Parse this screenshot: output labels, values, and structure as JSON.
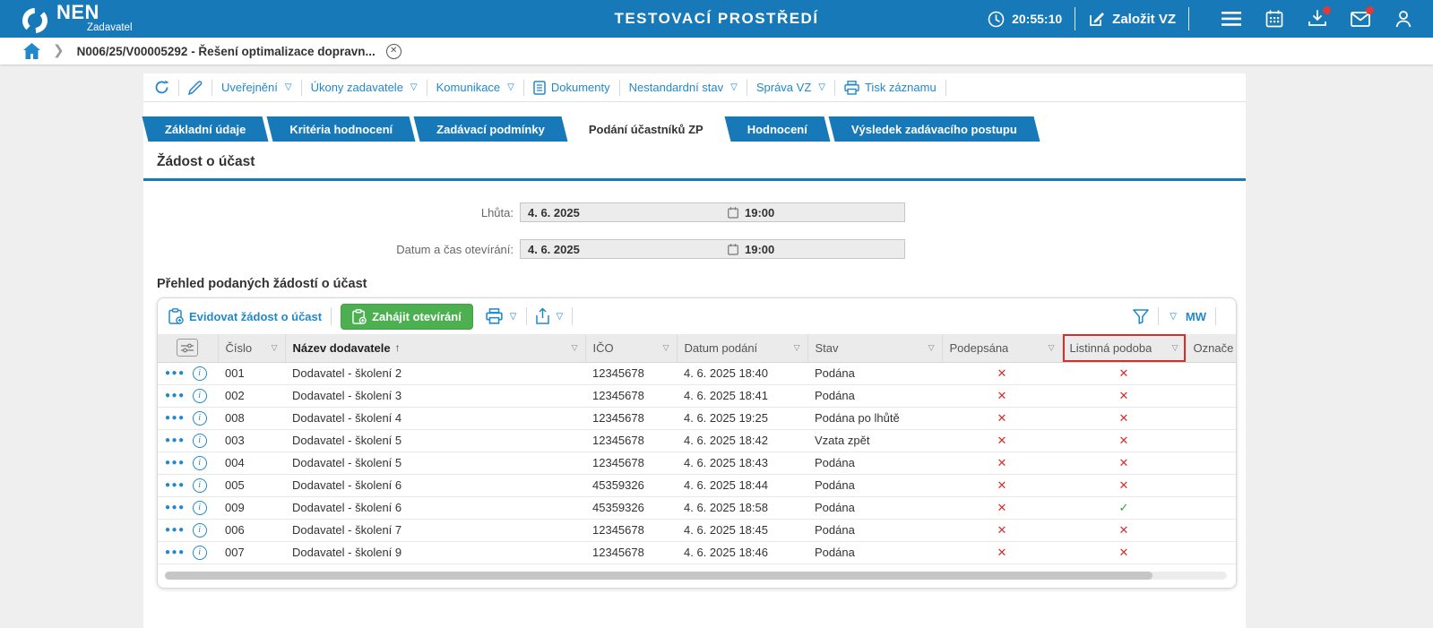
{
  "topbar": {
    "brand": "NEN",
    "brand_sub": "Zadavatel",
    "env_title": "TESTOVACÍ PROSTŘEDÍ",
    "time": "20:55:10",
    "create_vz": "Založit VZ"
  },
  "breadcrumb": {
    "item": "N006/25/V00005292 - Řešení optimalizace dopravn..."
  },
  "toolbar": {
    "uverejneni": "Uveřejnění",
    "ukony": "Úkony zadavatele",
    "komunikace": "Komunikace",
    "dokumenty": "Dokumenty",
    "nestandardni": "Nestandardní stav",
    "sprava": "Správa VZ",
    "tisk": "Tisk záznamu"
  },
  "tabs": {
    "items": [
      {
        "label": "Základní údaje"
      },
      {
        "label": "Kritéria hodnocení"
      },
      {
        "label": "Zadávací podmínky"
      },
      {
        "label": "Podání účastníků ZP"
      },
      {
        "label": "Hodnocení"
      },
      {
        "label": "Výsledek zadávacího postupu"
      }
    ],
    "active": "Podání účastníků ZP"
  },
  "section": {
    "title": "Žádost o účast"
  },
  "fields": {
    "lhuta": {
      "label": "Lhůta:",
      "date": "4. 6. 2025",
      "time": "19:00"
    },
    "oteviranie": {
      "label": "Datum a čas otevírání:",
      "date": "4. 6. 2025",
      "time": "19:00"
    }
  },
  "table": {
    "title": "Přehled podaných žádostí o účast",
    "actions": {
      "evidovat": "Evidovat žádost o účast",
      "zahajit": "Zahájit otevírání",
      "mw": "MW"
    },
    "columns": {
      "cislo": "Číslo",
      "nazev": "Název dodavatele",
      "ico": "IČO",
      "datum": "Datum podání",
      "stav": "Stav",
      "podepsana": "Podepsána",
      "listinna": "Listinná podoba",
      "oznacena": "Označe"
    },
    "rows": [
      {
        "cislo": "001",
        "nazev": "Dodavatel - školení 2",
        "ico": "12345678",
        "datum": "4. 6. 2025 18:40",
        "stav": "Podána",
        "podepsana": "✕",
        "listinna": "✕"
      },
      {
        "cislo": "002",
        "nazev": "Dodavatel - školení 3",
        "ico": "12345678",
        "datum": "4. 6. 2025 18:41",
        "stav": "Podána",
        "podepsana": "✕",
        "listinna": "✕"
      },
      {
        "cislo": "008",
        "nazev": "Dodavatel - školení 4",
        "ico": "12345678",
        "datum": "4. 6. 2025 19:25",
        "stav": "Podána po lhůtě",
        "podepsana": "✕",
        "listinna": "✕"
      },
      {
        "cislo": "003",
        "nazev": "Dodavatel - školení 5",
        "ico": "12345678",
        "datum": "4. 6. 2025 18:42",
        "stav": "Vzata zpět",
        "podepsana": "✕",
        "listinna": "✕"
      },
      {
        "cislo": "004",
        "nazev": "Dodavatel - školení 5",
        "ico": "12345678",
        "datum": "4. 6. 2025 18:43",
        "stav": "Podána",
        "podepsana": "✕",
        "listinna": "✕"
      },
      {
        "cislo": "005",
        "nazev": "Dodavatel - školení 6",
        "ico": "45359326",
        "datum": "4. 6. 2025 18:44",
        "stav": "Podána",
        "podepsana": "✕",
        "listinna": "✕"
      },
      {
        "cislo": "009",
        "nazev": "Dodavatel - školení 6",
        "ico": "45359326",
        "datum": "4. 6. 2025 18:58",
        "stav": "Podána",
        "podepsana": "✕",
        "listinna": "✓"
      },
      {
        "cislo": "006",
        "nazev": "Dodavatel - školení 7",
        "ico": "12345678",
        "datum": "4. 6. 2025 18:45",
        "stav": "Podána",
        "podepsana": "✕",
        "listinna": "✕"
      },
      {
        "cislo": "007",
        "nazev": "Dodavatel - školení 9",
        "ico": "12345678",
        "datum": "4. 6. 2025 18:46",
        "stav": "Podána",
        "podepsana": "✕",
        "listinna": "✕"
      }
    ]
  },
  "colors": {
    "brand_blue": "#1779b7",
    "link_blue": "#2288cc",
    "green_button": "#4caf50",
    "cross_red": "#d32f2f",
    "check_green": "#2fa235",
    "highlight_red": "#c9342c"
  }
}
